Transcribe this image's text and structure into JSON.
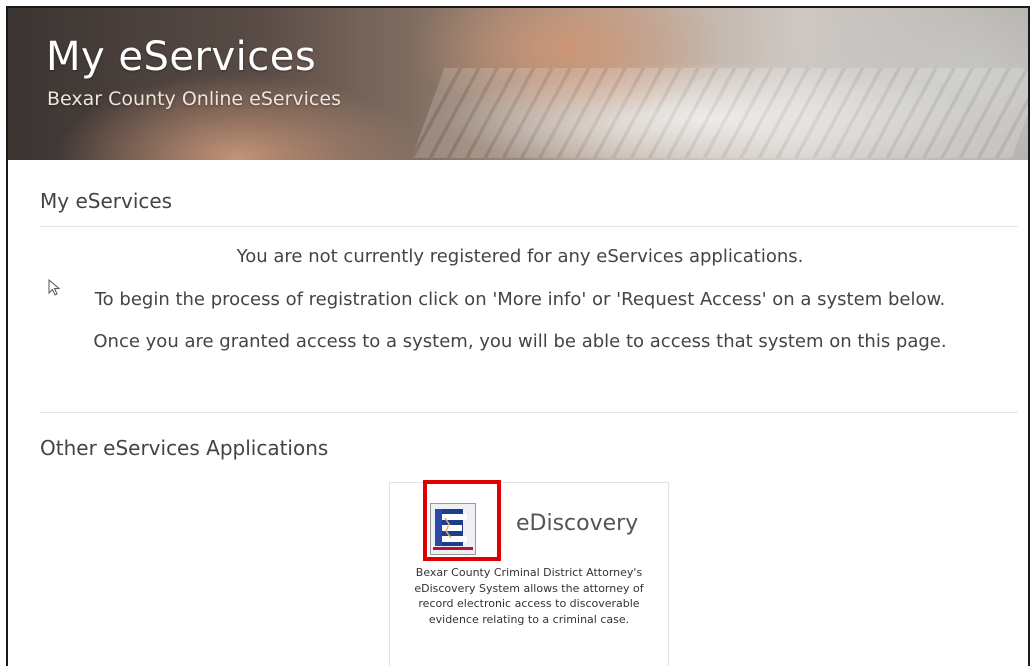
{
  "banner": {
    "title": "My eServices",
    "subtitle": "Bexar County Online eServices"
  },
  "my_eservices": {
    "title": "My eServices",
    "messages": [
      "You are not currently registered for any eServices applications.",
      "To begin the process of registration click on 'More info' or 'Request Access' on a system below.",
      "Once you are granted access to a system, you will be able to access that system on this page."
    ]
  },
  "other_apps": {
    "title": "Other eServices Applications",
    "apps": [
      {
        "name": "eDiscovery",
        "icon": "ediscovery-logo-icon",
        "description": "Bexar County Criminal District Attorney's eDiscovery System allows the attorney of record electronic access to discoverable evidence relating to a criminal case."
      }
    ]
  },
  "colors": {
    "highlight": "#e00000",
    "icon_blue": "#1f3c8f",
    "icon_red": "#b3132b"
  }
}
